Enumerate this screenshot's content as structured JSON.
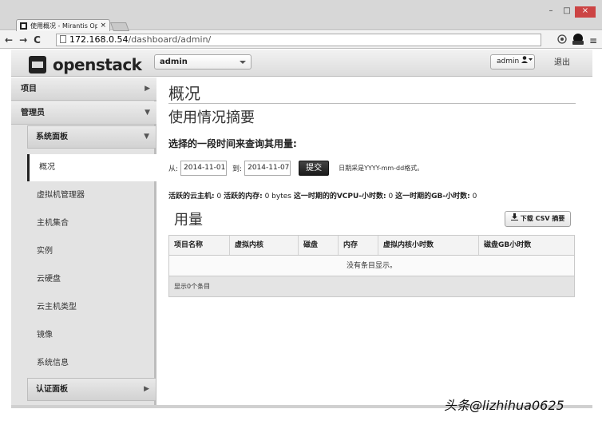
{
  "browser": {
    "tab_title": "使用概况 - Mirantis Ope",
    "tab_close": "×",
    "url_domain": "172.168.0.54",
    "url_path": "/dashboard/admin/",
    "nav_back": "←",
    "nav_forward": "→",
    "nav_reload": "C",
    "window_minimize": "–",
    "window_maximize": "□",
    "window_close": "×",
    "menu_icon": "≡"
  },
  "header": {
    "logo_text": "openstack",
    "project_select": "admin",
    "user_button": "admin",
    "logout": "退出"
  },
  "sidebar": {
    "categories": [
      {
        "label": "项目",
        "arrow": "▶"
      },
      {
        "label": "管理员",
        "arrow": "▼"
      }
    ],
    "panels": [
      {
        "label": "系统面板",
        "arrow": "▼"
      },
      {
        "label": "认证面板",
        "arrow": "▶"
      }
    ],
    "items": [
      {
        "label": "概况",
        "active": true
      },
      {
        "label": "虚拟机管理器"
      },
      {
        "label": "主机集合"
      },
      {
        "label": "实例"
      },
      {
        "label": "云硬盘"
      },
      {
        "label": "云主机类型"
      },
      {
        "label": "镜像"
      },
      {
        "label": "系统信息"
      }
    ]
  },
  "main": {
    "page_title": "概况",
    "subtitle": "使用情况摘要",
    "query_label": "选择的一段时间来查询其用量:",
    "from_label": "从:",
    "from_date": "2014-11-01",
    "to_label": "到:",
    "to_date": "2014-11-07",
    "submit": "提交",
    "date_hint": "日期采是YYYY-mm-dd格式。",
    "summary": {
      "active_instances_label": "活跃的云主机:",
      "active_instances_value": "0",
      "active_memory_label": "活跃的内存:",
      "active_memory_value": "0 bytes",
      "vcpu_hours_label": "这一时期的的VCPU-小时数:",
      "vcpu_hours_value": "0",
      "gb_hours_label": "这一时期的GB-小时数:",
      "gb_hours_value": "0"
    },
    "usage_title": "用量",
    "csv_button": "下载 CSV 摘要",
    "table": {
      "columns": [
        "项目名称",
        "虚拟内核",
        "磁盘",
        "内存",
        "虚拟内核小时数",
        "磁盘GB小时数"
      ],
      "empty_text": "没有条目显示。",
      "footer": "显示0个条目"
    }
  },
  "watermark": "头条@lizhihua0625"
}
